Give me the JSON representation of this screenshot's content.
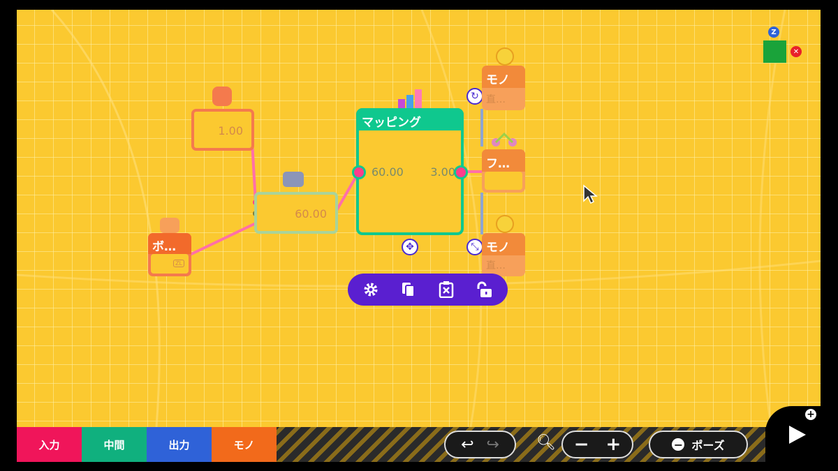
{
  "nodes": {
    "constant": {
      "value": "1.00"
    },
    "middle": {
      "value": "60.00"
    },
    "button": {
      "label": "ボ…",
      "badge": "ZL"
    },
    "mapping": {
      "title": "マッピング",
      "input_value": "60.00",
      "output_value": "3.00"
    },
    "thing_top": {
      "label": "モノ",
      "sub": "直…"
    },
    "thing_mid": {
      "label": "フ…"
    },
    "thing_bottom": {
      "label": "モノ",
      "sub": "直…"
    }
  },
  "toolbar": {
    "icons": [
      "gear-icon",
      "copy-icon",
      "delete-icon",
      "unlock-icon"
    ]
  },
  "minimap": {
    "badge": "Z"
  },
  "categories": [
    {
      "label": "入力",
      "color": "#f0155a"
    },
    {
      "label": "中間",
      "color": "#10b07e"
    },
    {
      "label": "出力",
      "color": "#2f62d8"
    },
    {
      "label": "モノ",
      "color": "#f26a1b"
    }
  ],
  "controls": {
    "pause_label": "ポーズ"
  },
  "colors": {
    "canvas": "#fbc930",
    "wire": "#ff6fa8",
    "accent": "#5a1fd0"
  }
}
